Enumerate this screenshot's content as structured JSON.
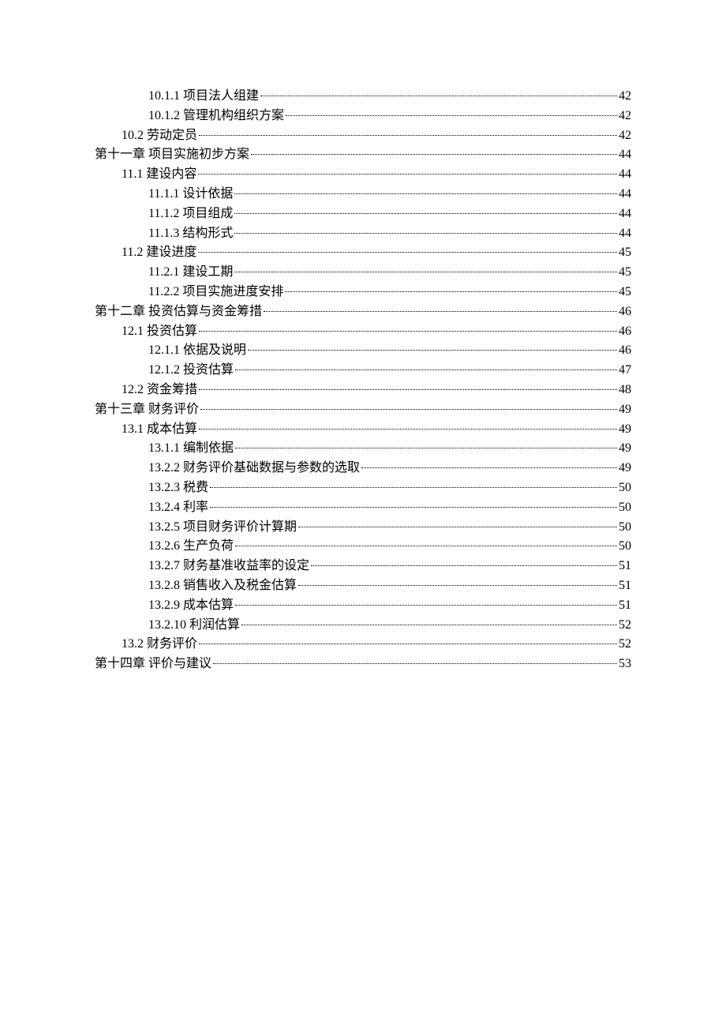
{
  "toc": [
    {
      "level": 2,
      "label": "10.1.1  项目法人组建",
      "page": "42"
    },
    {
      "level": 2,
      "label": "10.1.2  管理机构组织方案",
      "page": "42"
    },
    {
      "level": 1,
      "label": "10.2 劳动定员",
      "page": "42"
    },
    {
      "level": 0,
      "label": "第十一章  项目实施初步方案",
      "page": "44"
    },
    {
      "level": 1,
      "label": "11.1  建设内容",
      "page": "44"
    },
    {
      "level": 2,
      "label": "11.1.1  设计依据",
      "page": "44"
    },
    {
      "level": 2,
      "label": "11.1.2  项目组成",
      "page": "44"
    },
    {
      "level": 2,
      "label": "11.1.3  结构形式",
      "page": "44"
    },
    {
      "level": 1,
      "label": "11.2 建设进度",
      "page": "45"
    },
    {
      "level": 2,
      "label": "11.2.1  建设工期",
      "page": "45"
    },
    {
      "level": 2,
      "label": "11.2.2  项目实施进度安排",
      "page": "45"
    },
    {
      "level": 0,
      "label": "第十二章  投资估算与资金筹措",
      "page": "46"
    },
    {
      "level": 1,
      "label": "12.1  投资估算",
      "page": "46"
    },
    {
      "level": 2,
      "label": "12.1.1 依据及说明",
      "page": "46"
    },
    {
      "level": 2,
      "label": "12.1.2  投资估算",
      "page": "47"
    },
    {
      "level": 1,
      "label": "12.2 资金筹措",
      "page": "48"
    },
    {
      "level": 0,
      "label": "第十三章  财务评价",
      "page": "49"
    },
    {
      "level": 1,
      "label": "13.1 成本估算",
      "page": "49"
    },
    {
      "level": 2,
      "label": "13.1.1  编制依据",
      "page": "49"
    },
    {
      "level": 2,
      "label": "13.2.2  财务评价基础数据与参数的选取",
      "page": "49"
    },
    {
      "level": 2,
      "label": "13.2.3  税费",
      "page": "50"
    },
    {
      "level": 2,
      "label": "13.2.4  利率",
      "page": "50"
    },
    {
      "level": 2,
      "label": "13.2.5  项目财务评价计算期",
      "page": "50"
    },
    {
      "level": 2,
      "label": "13.2.6  生产负荷",
      "page": "50"
    },
    {
      "level": 2,
      "label": "13.2.7  财务基准收益率的设定",
      "page": "51"
    },
    {
      "level": 2,
      "label": "13.2.8  销售收入及税金估算",
      "page": "51"
    },
    {
      "level": 2,
      "label": "13.2.9  成本估算",
      "page": "51"
    },
    {
      "level": 2,
      "label": "13.2.10 利润估算",
      "page": "52"
    },
    {
      "level": 1,
      "label": "13.2 财务评价",
      "page": "52"
    },
    {
      "level": 0,
      "label": "第十四章  评价与建议",
      "page": "53"
    }
  ]
}
